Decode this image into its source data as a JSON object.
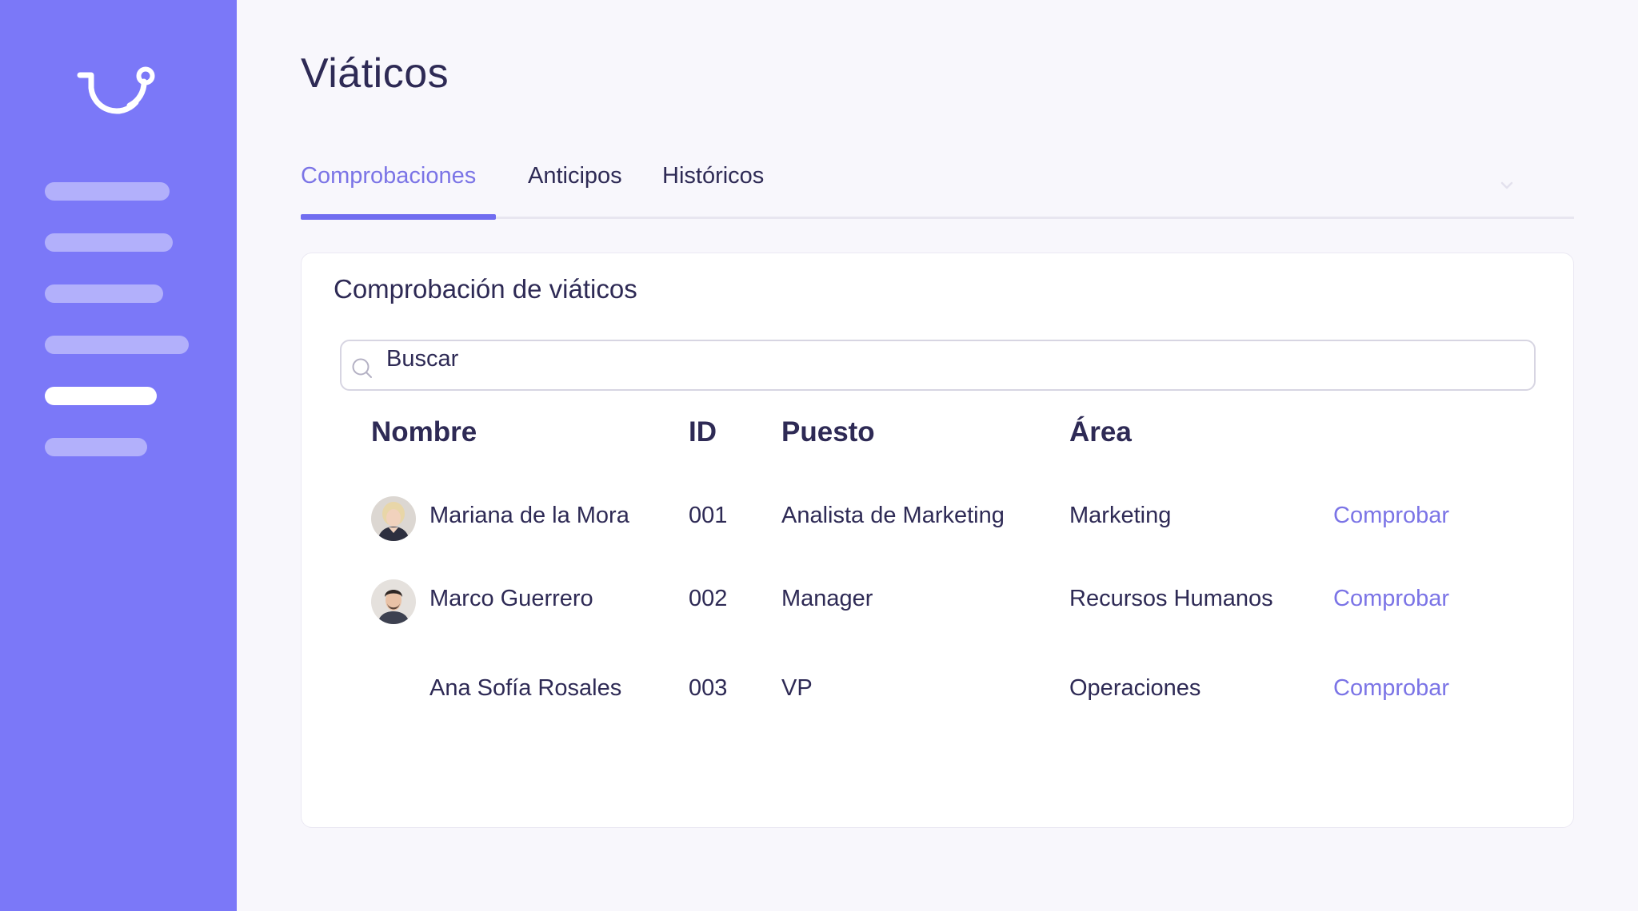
{
  "app": {
    "title": "Viáticos",
    "accent_color": "#7b78f8"
  },
  "sidebar": {
    "items": [
      {
        "icon": "nav-placeholder-bar",
        "active": false
      },
      {
        "icon": "nav-placeholder-bar",
        "active": false
      },
      {
        "icon": "nav-placeholder-bar",
        "active": false
      },
      {
        "icon": "nav-placeholder-bar",
        "active": false
      },
      {
        "icon": "nav-placeholder-bar",
        "active": true
      },
      {
        "icon": "nav-placeholder-bar",
        "active": false
      }
    ]
  },
  "tabs": [
    {
      "label": "Comprobaciones",
      "active": true
    },
    {
      "label": "Anticipos",
      "active": false
    },
    {
      "label": "Históricos",
      "active": false
    }
  ],
  "card": {
    "title": "Comprobación de viáticos"
  },
  "search": {
    "placeholder": "Buscar",
    "value": ""
  },
  "table": {
    "headers": {
      "name": "Nombre",
      "id": "ID",
      "position": "Puesto",
      "area": "Área"
    },
    "rows": [
      {
        "name": "Mariana de la Mora",
        "id": "001",
        "position": "Analista de Marketing",
        "area": "Marketing",
        "action": "Comprobar",
        "avatar": "female-avatar"
      },
      {
        "name": "Marco Guerrero",
        "id": "002",
        "position": "Manager",
        "area": "Recursos Humanos",
        "action": "Comprobar",
        "avatar": "male-avatar"
      },
      {
        "name": "Ana Sofía Rosales",
        "id": "003",
        "position": "VP",
        "area": "Operaciones",
        "action": "Comprobar",
        "avatar": null
      }
    ]
  }
}
